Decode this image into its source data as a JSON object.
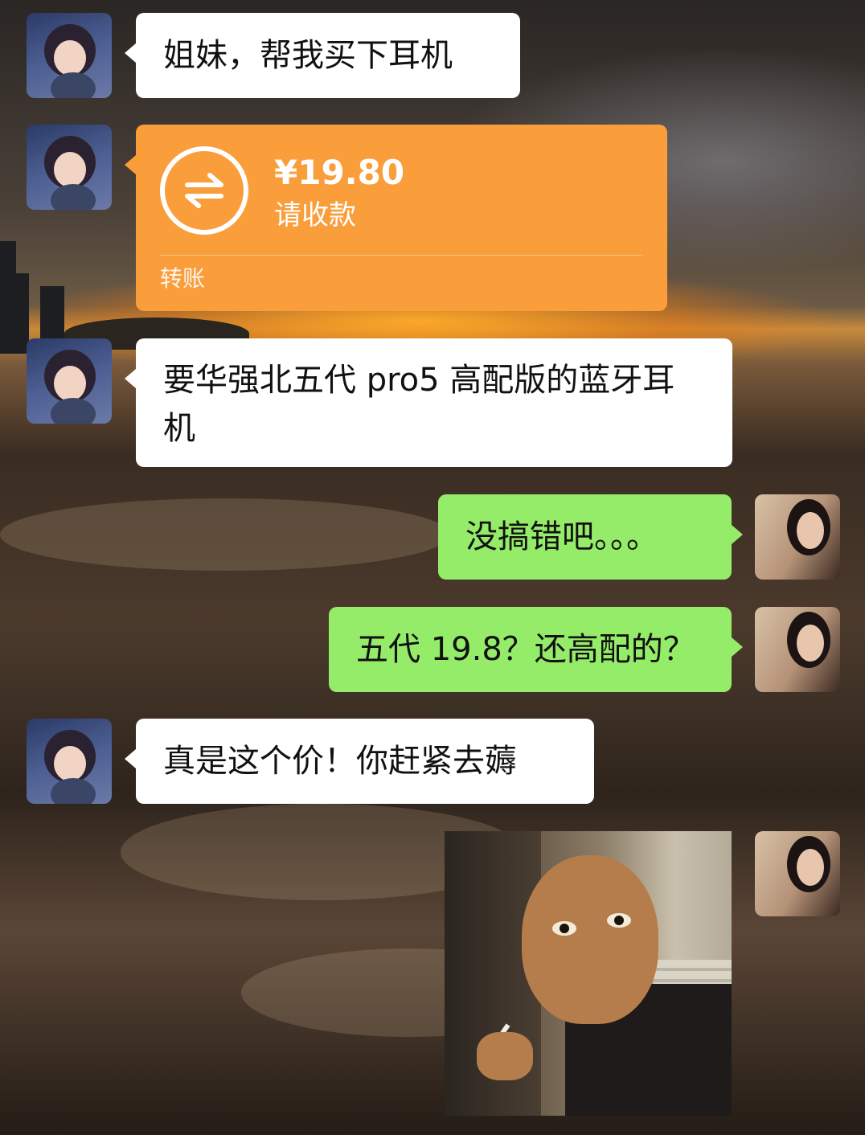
{
  "messages": [
    {
      "side": "left",
      "type": "text",
      "text": "姐妹，帮我买下耳机"
    },
    {
      "side": "left",
      "type": "transfer",
      "amount": "¥19.80",
      "note": "请收款",
      "label": "转账"
    },
    {
      "side": "left",
      "type": "text",
      "text": "要华强北五代 pro5 高配版的蓝牙耳机"
    },
    {
      "side": "right",
      "type": "text",
      "text": "没搞错吧。。。"
    },
    {
      "side": "right",
      "type": "text",
      "text": "五代 19.8？还高配的？"
    },
    {
      "side": "left",
      "type": "text",
      "text": "真是这个价！你赶紧去薅"
    },
    {
      "side": "right",
      "type": "image",
      "description": "meme-sticker"
    }
  ],
  "colors": {
    "white_bubble": "#ffffff",
    "green_bubble": "#95ec69",
    "transfer_card": "#fa9d3b"
  },
  "icons": {
    "transfer": "transfer-arrows-icon"
  }
}
